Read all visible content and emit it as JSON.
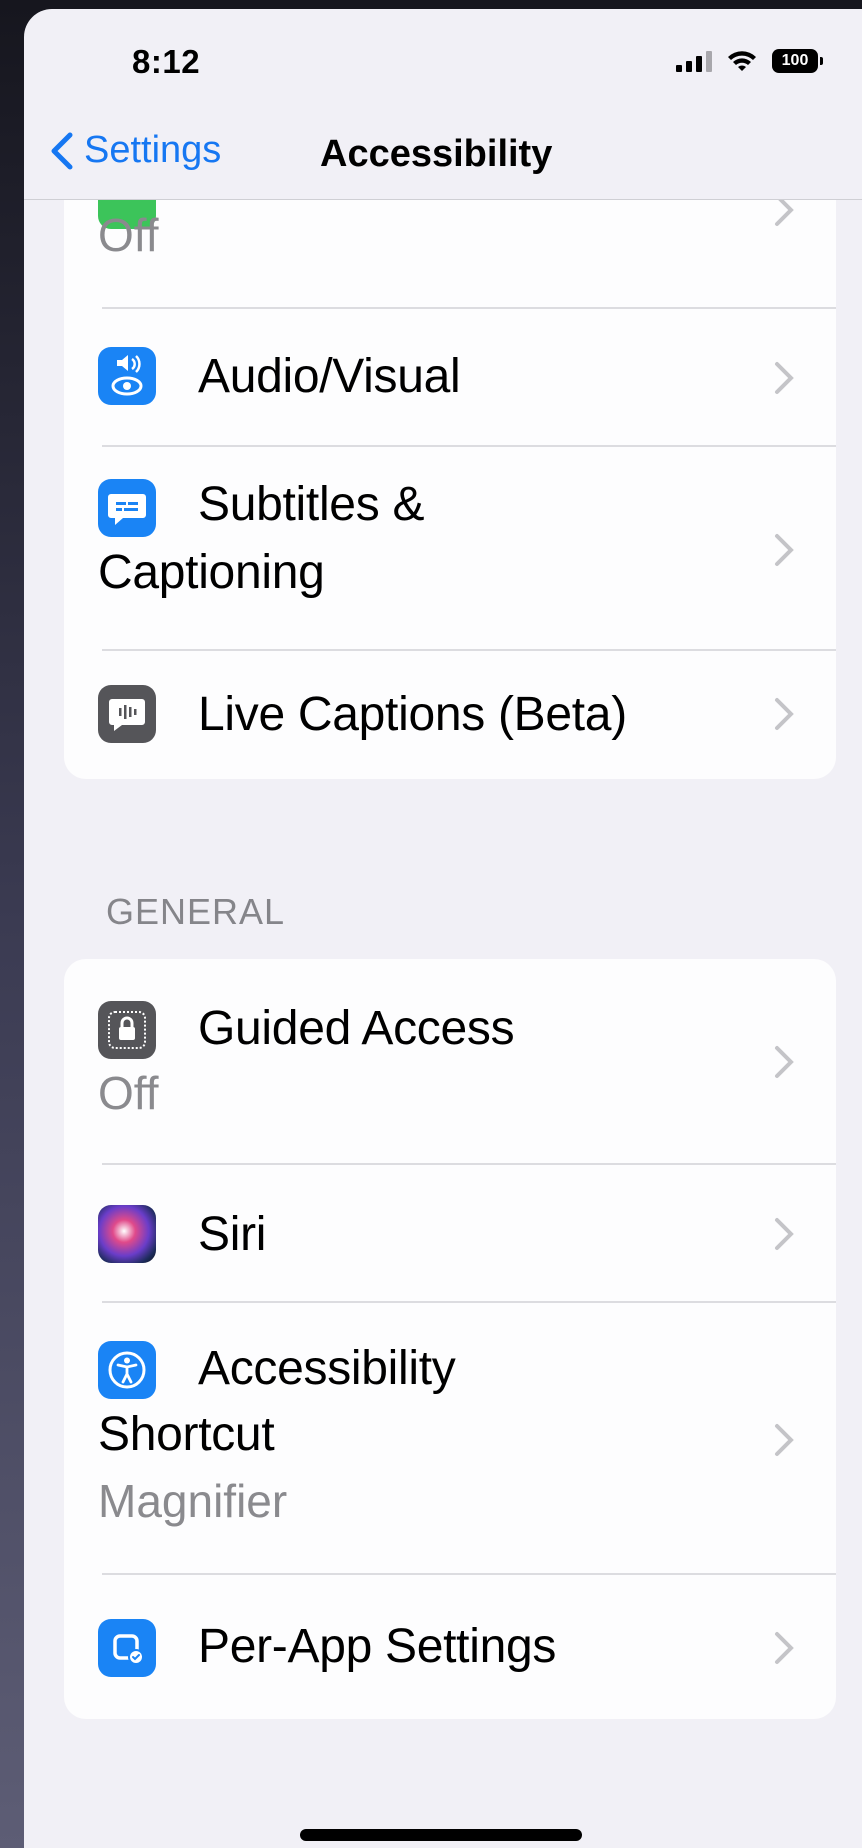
{
  "status": {
    "time": "8:12",
    "battery": "100"
  },
  "nav": {
    "back_label": "Settings",
    "title": "Accessibility"
  },
  "group1": {
    "partial_row": {
      "subtitle": "Off"
    },
    "audio_visual": {
      "label": "Audio/Visual"
    },
    "subtitles": {
      "label_line1": "Subtitles &",
      "label_line2": "Captioning"
    },
    "live_captions": {
      "label": "Live Captions (Beta)"
    }
  },
  "section_general": "GENERAL",
  "group2": {
    "guided_access": {
      "label": "Guided Access",
      "subtitle": "Off"
    },
    "siri": {
      "label": "Siri"
    },
    "shortcut": {
      "label_line1": "Accessibility",
      "label_line2": "Shortcut",
      "subtitle": "Magnifier"
    },
    "per_app": {
      "label": "Per-App Settings"
    }
  },
  "colors": {
    "accent": "#1677f2",
    "icon_blue": "#1a84f5",
    "icon_gray": "#555559",
    "background": "#f1f0f6"
  },
  "icons": {
    "audio_visual": "speaker-eye-icon",
    "subtitles": "caption-bubble-icon",
    "live_captions": "live-captions-icon",
    "guided_access": "lock-icon",
    "siri": "siri-icon",
    "shortcut": "accessibility-icon",
    "per_app": "per-app-icon"
  }
}
